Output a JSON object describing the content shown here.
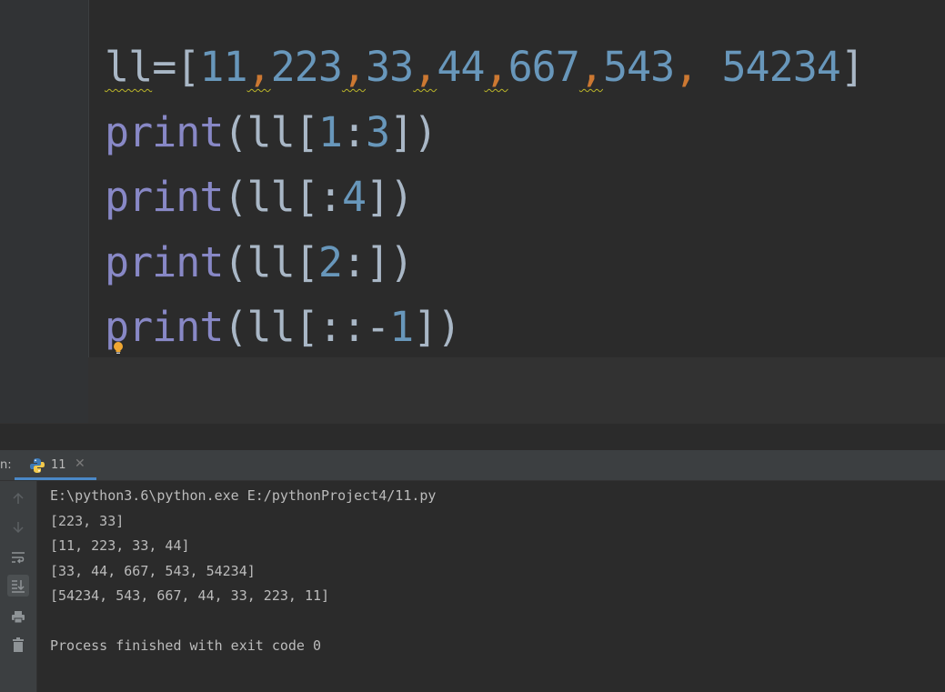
{
  "editor": {
    "lines": [
      [
        {
          "t": "ll",
          "c": "squig"
        },
        {
          "t": "=",
          "c": ""
        },
        {
          "t": "[",
          "c": ""
        },
        {
          "t": "11",
          "c": "num"
        },
        {
          "t": ",",
          "c": "op squig"
        },
        {
          "t": "223",
          "c": "num"
        },
        {
          "t": ",",
          "c": "op squig"
        },
        {
          "t": "33",
          "c": "num"
        },
        {
          "t": ",",
          "c": "op squig"
        },
        {
          "t": "44",
          "c": "num"
        },
        {
          "t": ",",
          "c": "op squig"
        },
        {
          "t": "667",
          "c": "num"
        },
        {
          "t": ",",
          "c": "op squig"
        },
        {
          "t": "543",
          "c": "num"
        },
        {
          "t": ",",
          "c": "op"
        },
        {
          "t": " ",
          "c": ""
        },
        {
          "t": "54234",
          "c": "num"
        },
        {
          "t": "]",
          "c": ""
        }
      ],
      [
        {
          "t": "print",
          "c": "kw"
        },
        {
          "t": "(ll[",
          "c": ""
        },
        {
          "t": "1",
          "c": "num"
        },
        {
          "t": ":",
          "c": ""
        },
        {
          "t": "3",
          "c": "num"
        },
        {
          "t": "])",
          "c": ""
        }
      ],
      [
        {
          "t": "print",
          "c": "kw"
        },
        {
          "t": "(ll[:",
          "c": ""
        },
        {
          "t": "4",
          "c": "num"
        },
        {
          "t": "])",
          "c": ""
        }
      ],
      [
        {
          "t": "print",
          "c": "kw"
        },
        {
          "t": "(ll[",
          "c": ""
        },
        {
          "t": "2",
          "c": "num"
        },
        {
          "t": ":])",
          "c": ""
        }
      ],
      [
        {
          "t": "print",
          "c": "kw"
        },
        {
          "t": "(ll[::-",
          "c": ""
        },
        {
          "t": "1",
          "c": "num"
        },
        {
          "t": "])",
          "c": ""
        }
      ]
    ]
  },
  "run_panel": {
    "label": "n:",
    "tab_name": "11",
    "close_glyph": "✕",
    "toolbar": [
      "arrow-up-icon",
      "arrow-down-icon",
      "soft-wrap-icon",
      "scroll-to-end-icon",
      "print-icon",
      "trash-icon"
    ]
  },
  "console": {
    "lines": [
      "E:\\python3.6\\python.exe E:/pythonProject4/11.py",
      "[223, 33]",
      "[11, 223, 33, 44]",
      "[33, 44, 667, 543, 54234]",
      "[54234, 543, 667, 44, 33, 223, 11]",
      "",
      "Process finished with exit code 0"
    ]
  },
  "colors": {
    "background": "#2b2b2b",
    "keyword": "#8888c6",
    "number": "#6897bb",
    "comma": "#cc7832",
    "text": "#a9b7c6",
    "accent": "#4a88c7"
  }
}
